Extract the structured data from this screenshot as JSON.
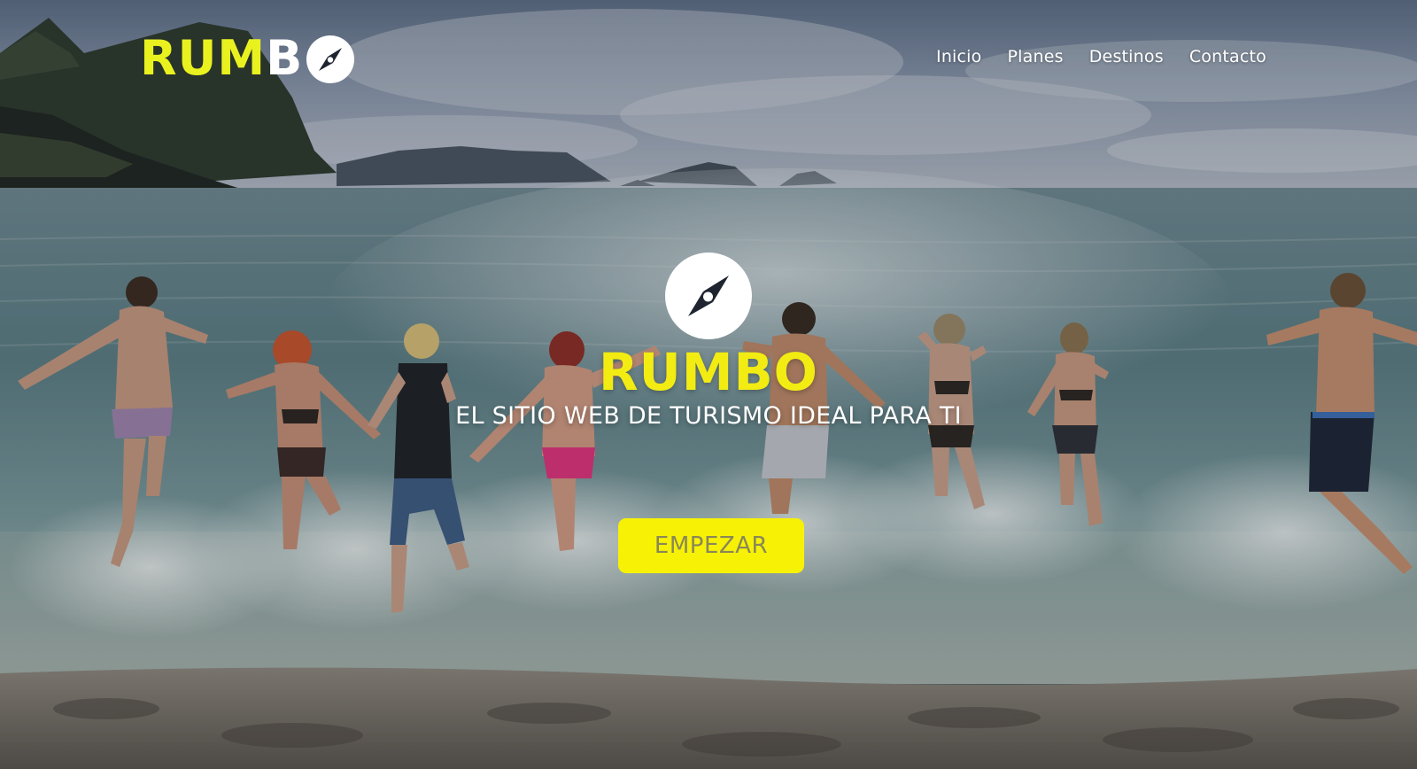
{
  "header": {
    "logo": {
      "text_part_yellow": "RUM",
      "text_part_white": "B",
      "icon": "compass-icon"
    },
    "nav": [
      {
        "label": "Inicio"
      },
      {
        "label": "Planes"
      },
      {
        "label": "Destinos"
      },
      {
        "label": "Contacto"
      }
    ]
  },
  "hero": {
    "icon": "compass-icon",
    "title": "RUMBO",
    "subtitle": "EL SITIO WEB DE TURISMO IDEAL PARA TI",
    "cta_label": "EMPEZAR",
    "background": "beach-swimmers-photo"
  },
  "colors": {
    "accent_yellow": "#f2ec13",
    "button_yellow": "#f7f205",
    "button_text": "#8a8757",
    "nav_text": "#ffffff"
  }
}
